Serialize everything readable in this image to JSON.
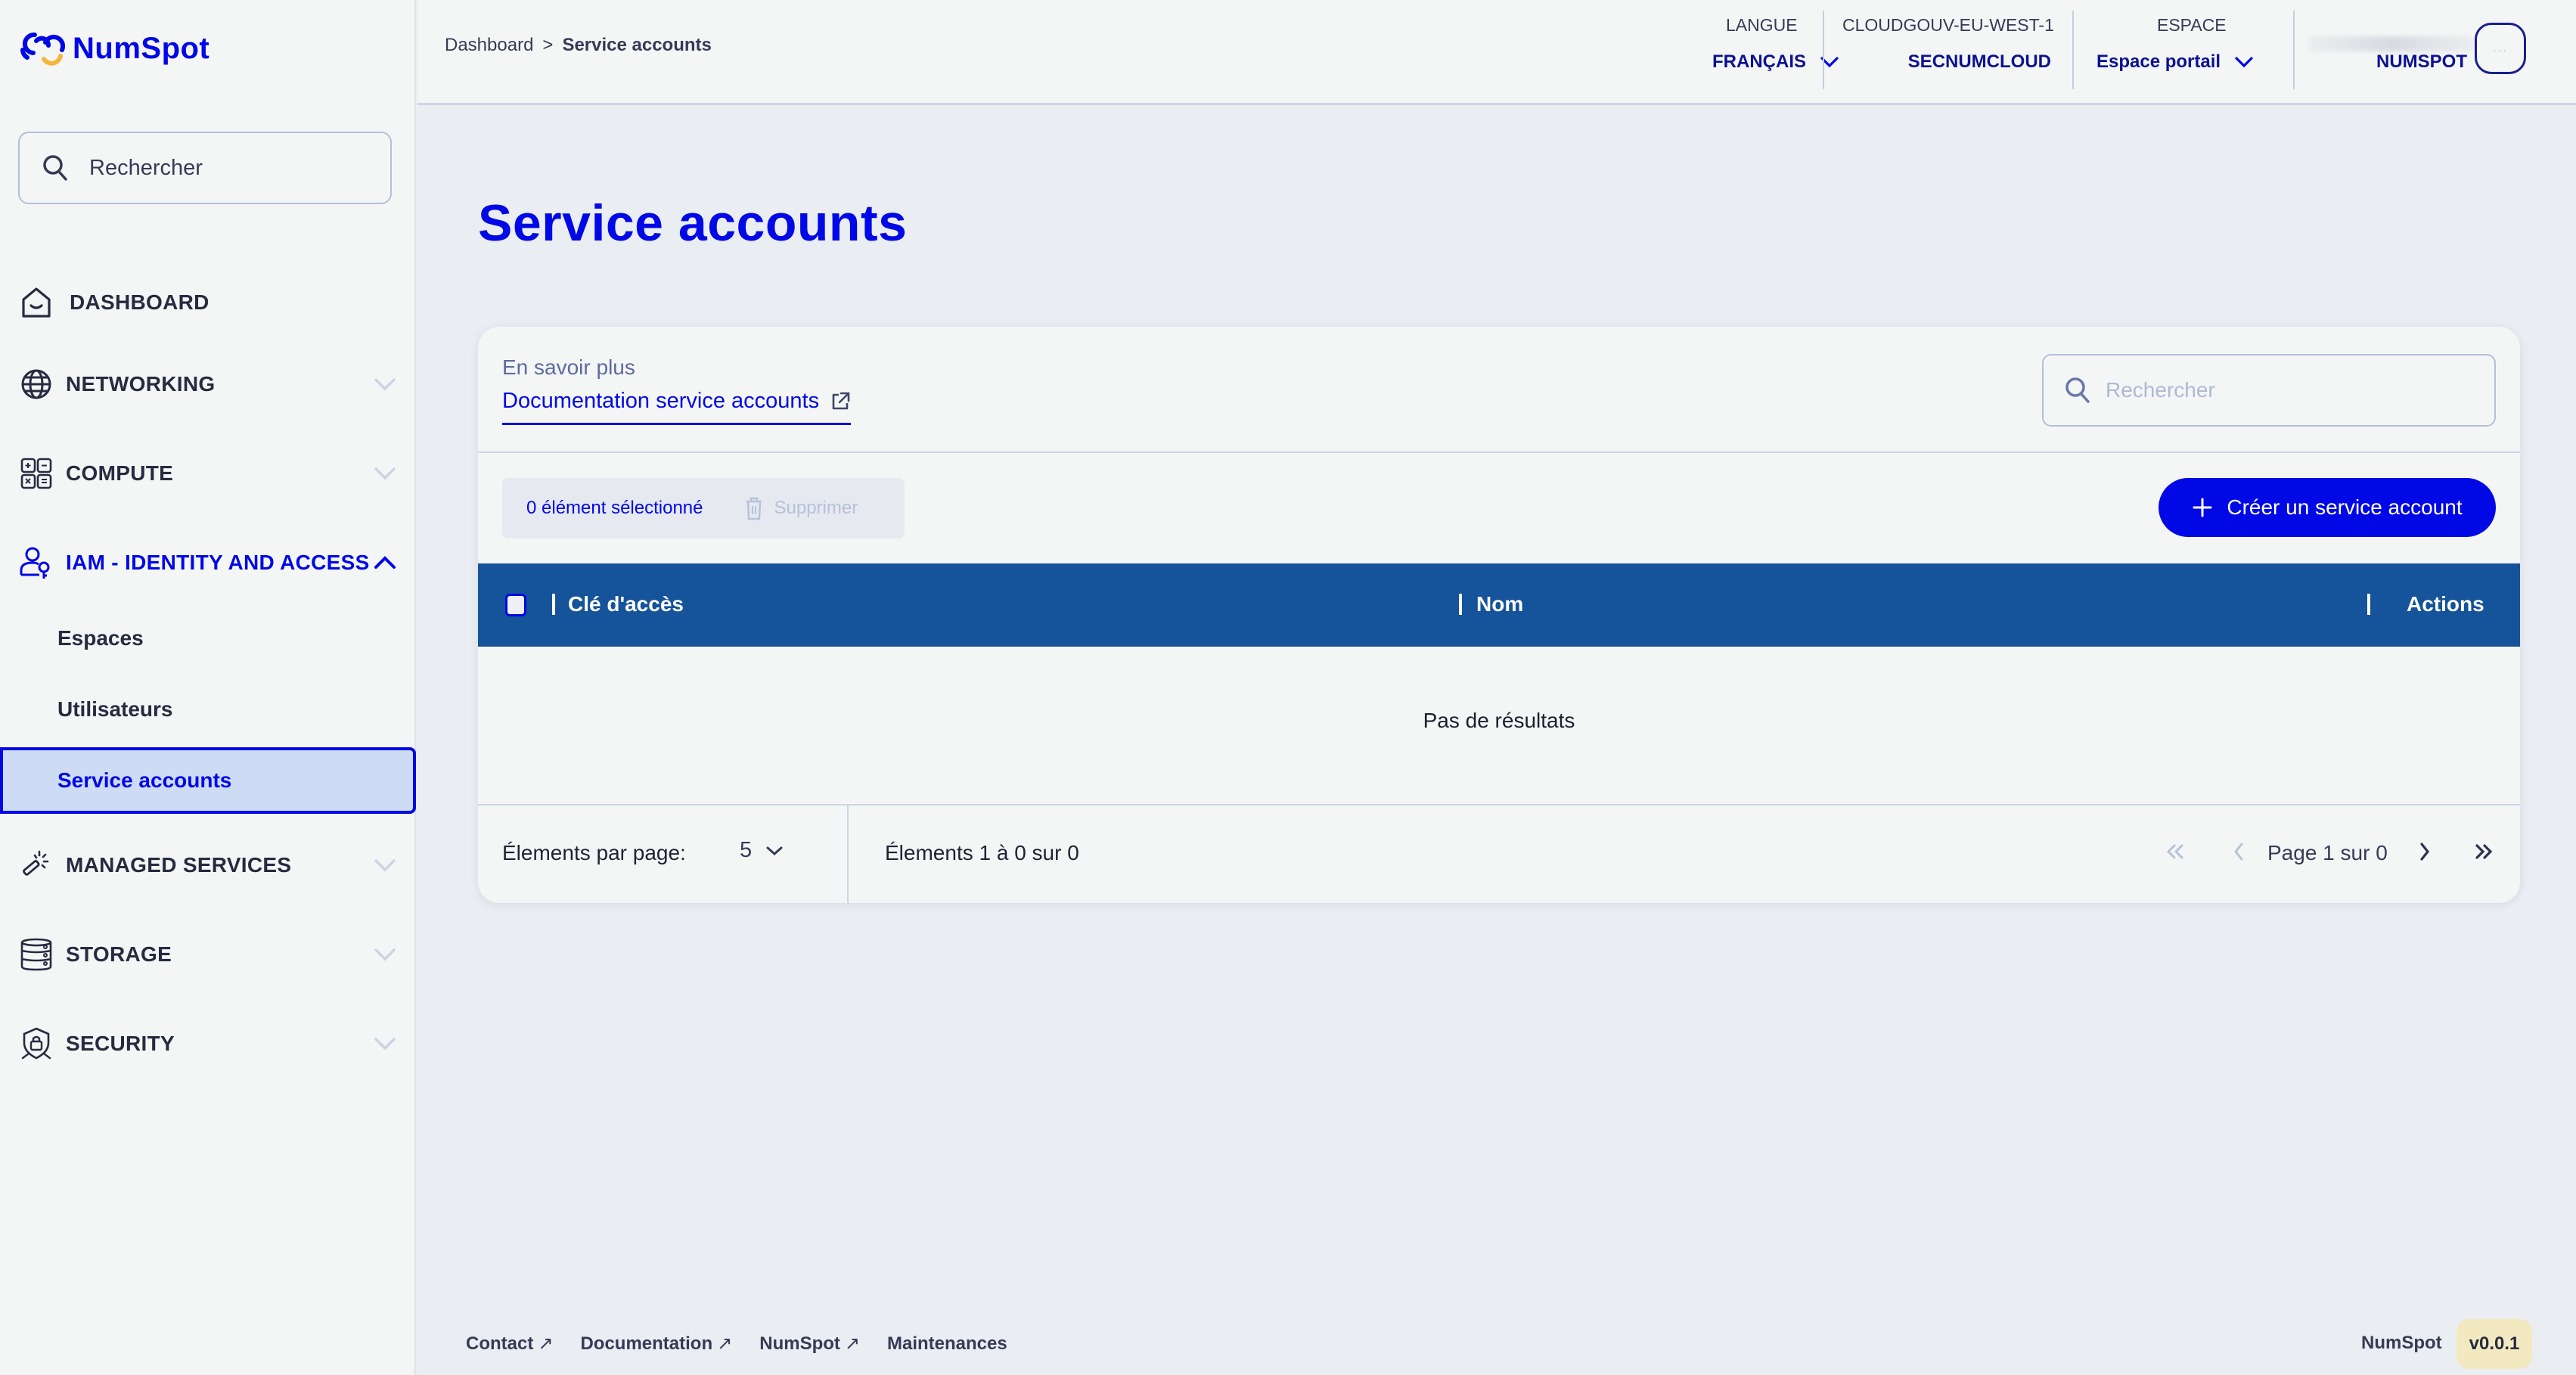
{
  "app": {
    "brand": "NumSpot"
  },
  "sidebar": {
    "search_placeholder": "Rechercher",
    "items": [
      {
        "label": "DASHBOARD",
        "icon": "home-icon",
        "expandable": false
      },
      {
        "label": "NETWORKING",
        "icon": "globe-icon",
        "expandable": true,
        "expanded": false
      },
      {
        "label": "COMPUTE",
        "icon": "calculator-icon",
        "expandable": true,
        "expanded": false
      },
      {
        "label": "IAM - IDENTITY AND ACCESS",
        "icon": "user-key-icon",
        "expandable": true,
        "expanded": true,
        "active": true,
        "children": [
          {
            "label": "Espaces"
          },
          {
            "label": "Utilisateurs"
          },
          {
            "label": "Service accounts",
            "selected": true
          }
        ]
      },
      {
        "label": "MANAGED SERVICES",
        "icon": "magic-wand-icon",
        "expandable": true,
        "expanded": false
      },
      {
        "label": "STORAGE",
        "icon": "database-icon",
        "expandable": true,
        "expanded": false
      },
      {
        "label": "SECURITY",
        "icon": "shield-lock-icon",
        "expandable": true,
        "expanded": false
      }
    ]
  },
  "header": {
    "breadcrumb": [
      {
        "label": "Dashboard"
      },
      {
        "label": "Service accounts",
        "current": true
      }
    ],
    "breadcrumb_separator": ">",
    "language": {
      "label": "LANGUE",
      "value": "FRANÇAIS"
    },
    "region": {
      "label": "CLOUDGOUV-EU-WEST-1",
      "value": "SECNUMCLOUD"
    },
    "space": {
      "label": "ESPACE",
      "value": "Espace portail"
    },
    "account": {
      "value": "NUMSPOT",
      "avatar_glyph": "..."
    }
  },
  "main": {
    "title": "Service accounts",
    "learn_more_label": "En savoir plus",
    "doc_link_label": "Documentation service accounts",
    "search_placeholder": "Rechercher",
    "selection_count": "0 élément sélectionné",
    "delete_label": "Supprimer",
    "create_label": "Créer un service account",
    "table": {
      "columns": [
        "Clé d'accès",
        "Nom",
        "Actions"
      ],
      "rows": [],
      "empty_message": "Pas de résultats"
    },
    "pagination": {
      "per_page_label": "Élements par page:",
      "per_page_value": "5",
      "range_text": "Élements 1 à 0 sur 0",
      "page_text": "Page 1 sur 0"
    }
  },
  "footer": {
    "links": [
      {
        "label": "Contact",
        "external": true,
        "arrow": "↗"
      },
      {
        "label": "Documentation",
        "external": true,
        "arrow": "↗"
      },
      {
        "label": "NumSpot",
        "external": true,
        "arrow": "↗"
      },
      {
        "label": "Maintenances",
        "external": false
      }
    ],
    "brand": "NumSpot",
    "version": "v0.0.1"
  },
  "colors": {
    "primary": "#0008e6",
    "table_header": "#15539a",
    "selected_bg": "#cddbf4",
    "version_badge": "#f3e9c1"
  }
}
